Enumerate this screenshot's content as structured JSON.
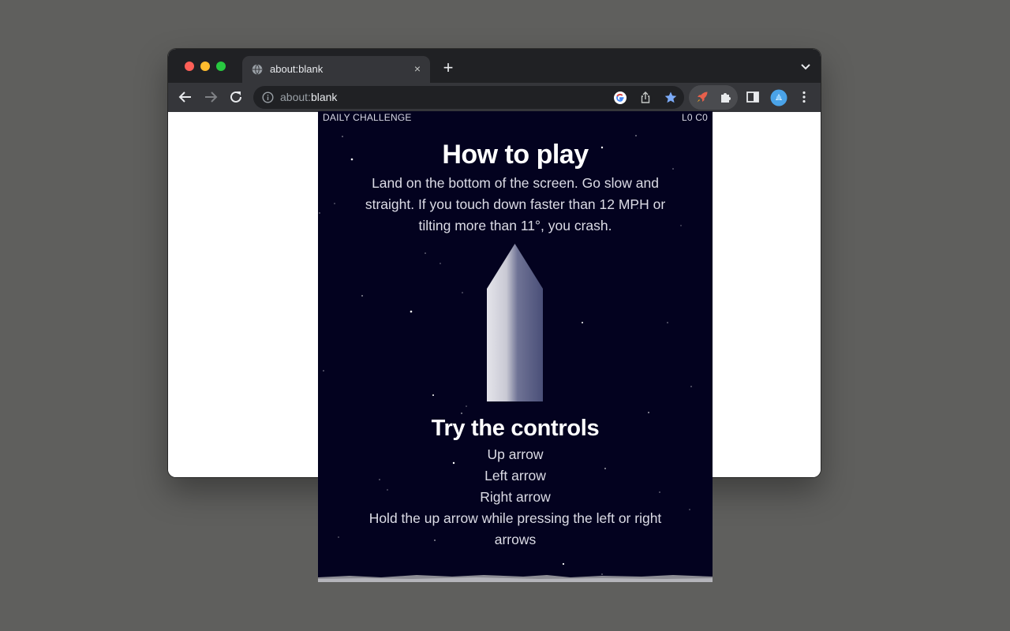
{
  "browser": {
    "tab_title": "about:blank",
    "tab_close": "×",
    "new_tab": "+",
    "url_scheme": "about:",
    "url_rest": "blank"
  },
  "game": {
    "hud_left": "DAILY CHALLENGE",
    "hud_right": "L0 C0",
    "title": "How to play",
    "description": "Land on the bottom of the screen. Go slow and straight. If you touch down faster than 12 MPH or tilting more than 11°, you crash.",
    "controls_title": "Try the controls",
    "controls": [
      "Up arrow",
      "Left arrow",
      "Right arrow",
      "Hold the up arrow while pressing the left or right arrows"
    ]
  },
  "colors": {
    "space_background": "#03021f",
    "rocket_light": "#e4e4ea",
    "rocket_dark": "#4a4f78",
    "toolbar": "#35363a",
    "tabbar": "#202124"
  },
  "icons": [
    "globe-icon",
    "close-icon",
    "plus-icon",
    "chevron-down-icon",
    "back-arrow-icon",
    "forward-arrow-icon",
    "reload-icon",
    "info-icon",
    "google-icon",
    "share-icon",
    "bookmark-star-icon",
    "rocket-extension-icon",
    "puzzle-extensions-icon",
    "side-panel-icon",
    "profile-avatar-icon",
    "more-menu-icon"
  ]
}
